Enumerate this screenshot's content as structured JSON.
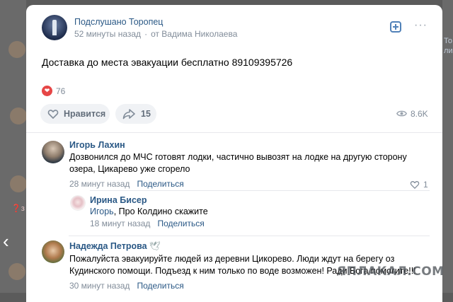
{
  "background": {
    "right_snippet_1": "То",
    "right_snippet_2": "ли",
    "left_snippet": "❓з"
  },
  "post": {
    "group_name": "Подслушано Торопец",
    "time": "52 минуты назад",
    "from": "от Вадима Николаева",
    "text": "Доставка до места эвакуации бесплатно 89109395726",
    "reactions_count": "76",
    "like_label": "Нравится",
    "share_count": "15",
    "views": "8.6K"
  },
  "comments": [
    {
      "author": "Игорь Лахин",
      "text": "Дозвонился до МЧС готовят лодки, частично вывозят на лодке на другую сторону озера, Цикарево уже сгорело",
      "time": "28 минут назад",
      "reply_label": "Поделиться",
      "likes": "1"
    },
    {
      "author": "Ирина Бисер",
      "reply_to": "Игорь",
      "text": ", Про Колдино скажите",
      "time": "18 минут назад",
      "reply_label": "Поделиться"
    },
    {
      "author": "Надежда Петрова",
      "author_emoji": "🕊",
      "text": "Пожалуйста эвакуируйте людей из деревни Цикорево. Люди ждут на берегу оз Кудинского помощи. Подъезд к ним только по воде возможен! Ради Бога помогите!!!",
      "time": "30 минут назад",
      "reply_label": "Поделиться"
    }
  ],
  "watermark": "ЯПЛАКАЛ.COM",
  "colors": {
    "link": "#2a5885",
    "meta": "#818c99",
    "heart": "#e64646",
    "accent": "#5181b8"
  }
}
